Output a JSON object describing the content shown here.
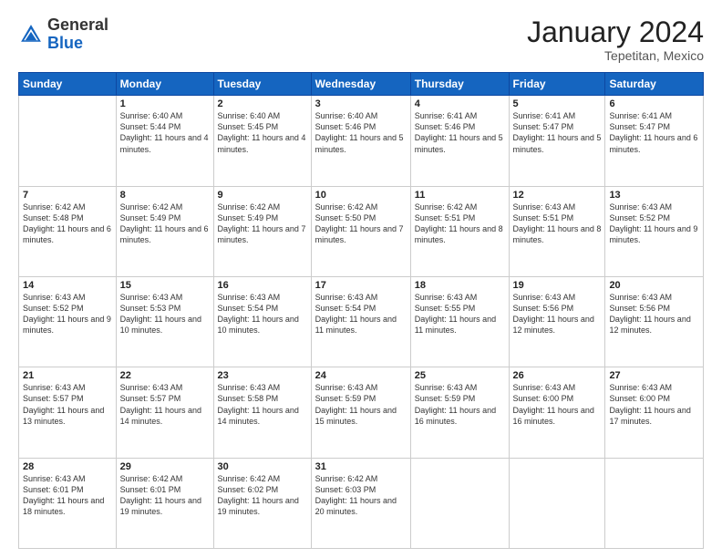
{
  "logo": {
    "general": "General",
    "blue": "Blue"
  },
  "header": {
    "month": "January 2024",
    "location": "Tepetitan, Mexico"
  },
  "days_of_week": [
    "Sunday",
    "Monday",
    "Tuesday",
    "Wednesday",
    "Thursday",
    "Friday",
    "Saturday"
  ],
  "weeks": [
    [
      {
        "day": "",
        "sunrise": "",
        "sunset": "",
        "daylight": ""
      },
      {
        "day": "1",
        "sunrise": "Sunrise: 6:40 AM",
        "sunset": "Sunset: 5:44 PM",
        "daylight": "Daylight: 11 hours and 4 minutes."
      },
      {
        "day": "2",
        "sunrise": "Sunrise: 6:40 AM",
        "sunset": "Sunset: 5:45 PM",
        "daylight": "Daylight: 11 hours and 4 minutes."
      },
      {
        "day": "3",
        "sunrise": "Sunrise: 6:40 AM",
        "sunset": "Sunset: 5:46 PM",
        "daylight": "Daylight: 11 hours and 5 minutes."
      },
      {
        "day": "4",
        "sunrise": "Sunrise: 6:41 AM",
        "sunset": "Sunset: 5:46 PM",
        "daylight": "Daylight: 11 hours and 5 minutes."
      },
      {
        "day": "5",
        "sunrise": "Sunrise: 6:41 AM",
        "sunset": "Sunset: 5:47 PM",
        "daylight": "Daylight: 11 hours and 5 minutes."
      },
      {
        "day": "6",
        "sunrise": "Sunrise: 6:41 AM",
        "sunset": "Sunset: 5:47 PM",
        "daylight": "Daylight: 11 hours and 6 minutes."
      }
    ],
    [
      {
        "day": "7",
        "sunrise": "Sunrise: 6:42 AM",
        "sunset": "Sunset: 5:48 PM",
        "daylight": "Daylight: 11 hours and 6 minutes."
      },
      {
        "day": "8",
        "sunrise": "Sunrise: 6:42 AM",
        "sunset": "Sunset: 5:49 PM",
        "daylight": "Daylight: 11 hours and 6 minutes."
      },
      {
        "day": "9",
        "sunrise": "Sunrise: 6:42 AM",
        "sunset": "Sunset: 5:49 PM",
        "daylight": "Daylight: 11 hours and 7 minutes."
      },
      {
        "day": "10",
        "sunrise": "Sunrise: 6:42 AM",
        "sunset": "Sunset: 5:50 PM",
        "daylight": "Daylight: 11 hours and 7 minutes."
      },
      {
        "day": "11",
        "sunrise": "Sunrise: 6:42 AM",
        "sunset": "Sunset: 5:51 PM",
        "daylight": "Daylight: 11 hours and 8 minutes."
      },
      {
        "day": "12",
        "sunrise": "Sunrise: 6:43 AM",
        "sunset": "Sunset: 5:51 PM",
        "daylight": "Daylight: 11 hours and 8 minutes."
      },
      {
        "day": "13",
        "sunrise": "Sunrise: 6:43 AM",
        "sunset": "Sunset: 5:52 PM",
        "daylight": "Daylight: 11 hours and 9 minutes."
      }
    ],
    [
      {
        "day": "14",
        "sunrise": "Sunrise: 6:43 AM",
        "sunset": "Sunset: 5:52 PM",
        "daylight": "Daylight: 11 hours and 9 minutes."
      },
      {
        "day": "15",
        "sunrise": "Sunrise: 6:43 AM",
        "sunset": "Sunset: 5:53 PM",
        "daylight": "Daylight: 11 hours and 10 minutes."
      },
      {
        "day": "16",
        "sunrise": "Sunrise: 6:43 AM",
        "sunset": "Sunset: 5:54 PM",
        "daylight": "Daylight: 11 hours and 10 minutes."
      },
      {
        "day": "17",
        "sunrise": "Sunrise: 6:43 AM",
        "sunset": "Sunset: 5:54 PM",
        "daylight": "Daylight: 11 hours and 11 minutes."
      },
      {
        "day": "18",
        "sunrise": "Sunrise: 6:43 AM",
        "sunset": "Sunset: 5:55 PM",
        "daylight": "Daylight: 11 hours and 11 minutes."
      },
      {
        "day": "19",
        "sunrise": "Sunrise: 6:43 AM",
        "sunset": "Sunset: 5:56 PM",
        "daylight": "Daylight: 11 hours and 12 minutes."
      },
      {
        "day": "20",
        "sunrise": "Sunrise: 6:43 AM",
        "sunset": "Sunset: 5:56 PM",
        "daylight": "Daylight: 11 hours and 12 minutes."
      }
    ],
    [
      {
        "day": "21",
        "sunrise": "Sunrise: 6:43 AM",
        "sunset": "Sunset: 5:57 PM",
        "daylight": "Daylight: 11 hours and 13 minutes."
      },
      {
        "day": "22",
        "sunrise": "Sunrise: 6:43 AM",
        "sunset": "Sunset: 5:57 PM",
        "daylight": "Daylight: 11 hours and 14 minutes."
      },
      {
        "day": "23",
        "sunrise": "Sunrise: 6:43 AM",
        "sunset": "Sunset: 5:58 PM",
        "daylight": "Daylight: 11 hours and 14 minutes."
      },
      {
        "day": "24",
        "sunrise": "Sunrise: 6:43 AM",
        "sunset": "Sunset: 5:59 PM",
        "daylight": "Daylight: 11 hours and 15 minutes."
      },
      {
        "day": "25",
        "sunrise": "Sunrise: 6:43 AM",
        "sunset": "Sunset: 5:59 PM",
        "daylight": "Daylight: 11 hours and 16 minutes."
      },
      {
        "day": "26",
        "sunrise": "Sunrise: 6:43 AM",
        "sunset": "Sunset: 6:00 PM",
        "daylight": "Daylight: 11 hours and 16 minutes."
      },
      {
        "day": "27",
        "sunrise": "Sunrise: 6:43 AM",
        "sunset": "Sunset: 6:00 PM",
        "daylight": "Daylight: 11 hours and 17 minutes."
      }
    ],
    [
      {
        "day": "28",
        "sunrise": "Sunrise: 6:43 AM",
        "sunset": "Sunset: 6:01 PM",
        "daylight": "Daylight: 11 hours and 18 minutes."
      },
      {
        "day": "29",
        "sunrise": "Sunrise: 6:42 AM",
        "sunset": "Sunset: 6:01 PM",
        "daylight": "Daylight: 11 hours and 19 minutes."
      },
      {
        "day": "30",
        "sunrise": "Sunrise: 6:42 AM",
        "sunset": "Sunset: 6:02 PM",
        "daylight": "Daylight: 11 hours and 19 minutes."
      },
      {
        "day": "31",
        "sunrise": "Sunrise: 6:42 AM",
        "sunset": "Sunset: 6:03 PM",
        "daylight": "Daylight: 11 hours and 20 minutes."
      },
      {
        "day": "",
        "sunrise": "",
        "sunset": "",
        "daylight": ""
      },
      {
        "day": "",
        "sunrise": "",
        "sunset": "",
        "daylight": ""
      },
      {
        "day": "",
        "sunrise": "",
        "sunset": "",
        "daylight": ""
      }
    ]
  ]
}
